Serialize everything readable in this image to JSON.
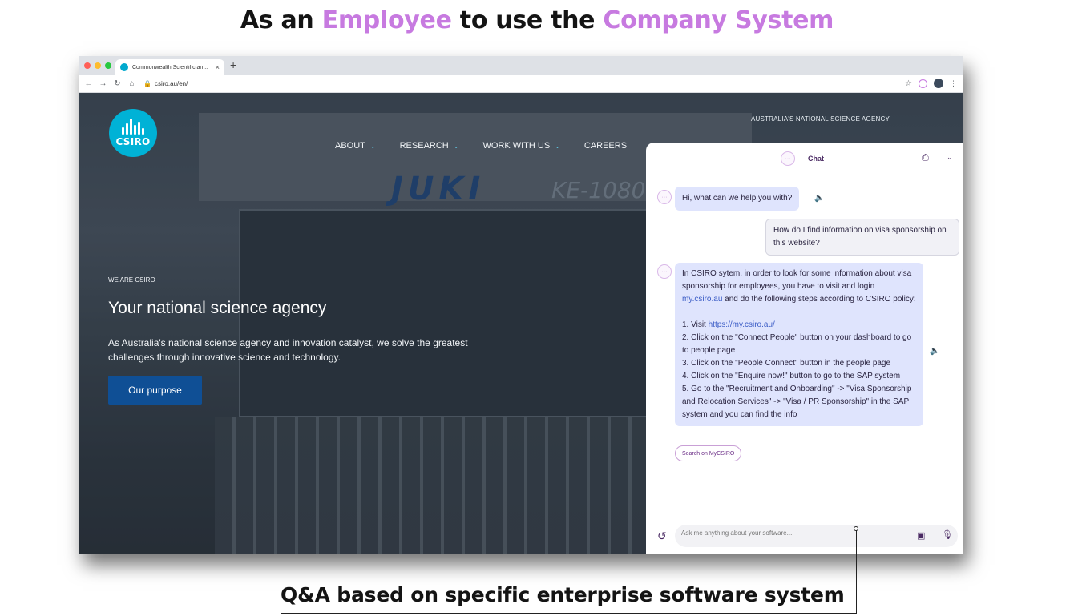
{
  "headline": {
    "prefix": "As an",
    "role": "Employee",
    "middle": "to use the",
    "system": "Company System",
    "accent_color": "#c77ae0"
  },
  "browser": {
    "tab_title": "Commonwealth Scientific an...",
    "tab_close": "×",
    "new_tab": "+",
    "url": "csiro.au/en/",
    "icons": [
      "back-arrow-icon",
      "forward-arrow-icon",
      "reload-icon",
      "home-icon",
      "lock-icon",
      "star-icon",
      "extension-icon",
      "profile-icon",
      "menu-icon"
    ]
  },
  "site": {
    "logo_text": "CSIRO",
    "tagline": "AUSTRALIA'S NATIONAL SCIENCE AGENCY",
    "nav": [
      "ABOUT",
      "RESEARCH",
      "WORK WITH US",
      "CAREERS"
    ],
    "machine_brand": "JUKI",
    "machine_model": "KE-1080",
    "kicker": "WE ARE CSIRO",
    "hero_title": "Your national science agency",
    "hero_desc": "As Australia's national science agency and innovation catalyst, we solve the greatest challenges through innovative science and technology.",
    "cta": "Our purpose",
    "brand_color": "#00b2d6",
    "cta_color": "#0f4f95"
  },
  "chat": {
    "title": "Chat",
    "greeting": "Hi, what can we help you with?",
    "user_question": "How do I find information on visa sponsorship on this website?",
    "answer": {
      "intro_before_link": "In CSIRO sytem, in order to look for some information about visa sponsorship for employees, you have to visit and login",
      "intro_link": "my.csiro.au",
      "intro_after_link": "and do the following steps according to CSIRO policy:",
      "step1_prefix": "1. Visit",
      "step1_link": "https://my.csiro.au/",
      "step2": "2. Click on the \"Connect People\" button on your dashboard to go to people page",
      "step3": "3. Click on the \"People Connect\" button in the people page",
      "step4": "4. Click on the \"Enquire now!\" button to go to the SAP system",
      "step5": "5. Go to the \"Recruitment and Onboarding\" -> \"Visa Sponsorship and Relocation Services\" -> \"Visa / PR Sponsorship\" in the SAP system and you can find the info"
    },
    "search_chip": "Search on MyCSIRO",
    "input_placeholder": "Ask me anything about your software...",
    "bot_bubble_color": "#dfe4fd"
  },
  "caption": "Q&A based on specific enterprise software system"
}
